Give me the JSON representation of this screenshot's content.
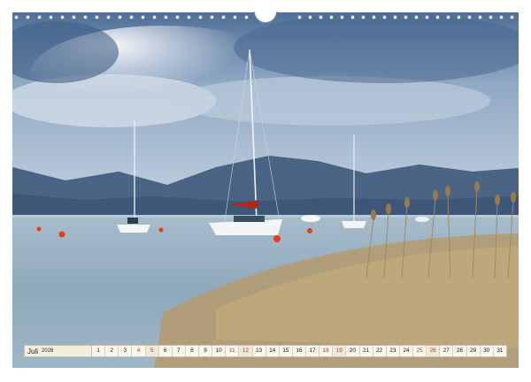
{
  "calendar": {
    "month": "Juli",
    "year": "2026",
    "days": [
      "1",
      "2",
      "3",
      "4",
      "5",
      "6",
      "7",
      "8",
      "9",
      "10",
      "11",
      "12",
      "13",
      "14",
      "15",
      "16",
      "17",
      "18",
      "19",
      "20",
      "21",
      "22",
      "23",
      "24",
      "25",
      "26",
      "27",
      "28",
      "29",
      "30",
      "31"
    ],
    "weekend_days": [
      4,
      5,
      11,
      12,
      18,
      19,
      25,
      26
    ],
    "sundays": [
      5,
      12,
      19,
      26
    ]
  },
  "colors": {
    "sky_top": "#5d7fa8",
    "sky_bottom": "#b9c8d8",
    "mountains": "#4b6486",
    "water": "#9bb3c4",
    "reeds": "#b49b6d",
    "buoy": "#e2401c"
  }
}
